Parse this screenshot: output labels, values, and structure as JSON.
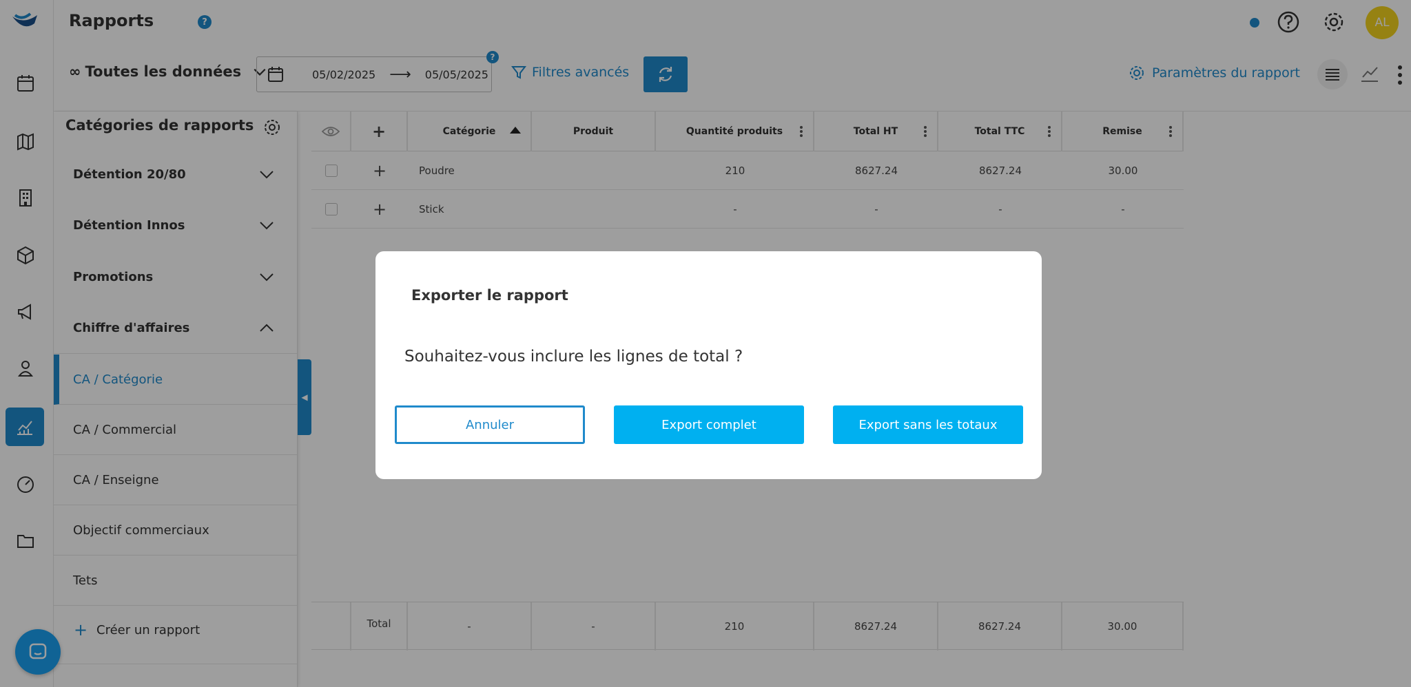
{
  "header": {
    "title": "Rapports",
    "help_glyph": "?",
    "avatar_initials": "AL"
  },
  "toolbar": {
    "dataset_label": "Toutes les données",
    "date_start": "05/02/2025",
    "date_end": "05/05/2025",
    "date_help_glyph": "?",
    "filters_label": "Filtres avancés",
    "params_label": "Paramètres du rapport"
  },
  "sidebar": {
    "title": "Catégories de rapports",
    "sections": [
      {
        "label": "Détention 20/80",
        "expanded": false
      },
      {
        "label": "Détention Innos",
        "expanded": false
      },
      {
        "label": "Promotions",
        "expanded": false
      },
      {
        "label": "Chiffre d'affaires",
        "expanded": true
      }
    ],
    "items": [
      {
        "label": "CA / Catégorie",
        "active": true
      },
      {
        "label": "CA / Commercial",
        "active": false
      },
      {
        "label": "CA / Enseigne",
        "active": false
      },
      {
        "label": "Objectif commerciaux",
        "active": false
      },
      {
        "label": "Tets",
        "active": false
      }
    ],
    "create_label": "Créer un rapport"
  },
  "table": {
    "columns": [
      "Catégorie",
      "Produit",
      "Quantité produits",
      "Total HT",
      "Total TTC",
      "Remise"
    ],
    "rows": [
      {
        "categorie": "Poudre",
        "produit": "",
        "quantite": "210",
        "total_ht": "8627.24",
        "total_ttc": "8627.24",
        "remise": "30.00"
      },
      {
        "categorie": "Stick",
        "produit": "",
        "quantite": "-",
        "total_ht": "-",
        "total_ttc": "-",
        "remise": "-"
      }
    ],
    "footer": {
      "label": "Total",
      "categorie": "-",
      "produit": "-",
      "quantite": "210",
      "total_ht": "8627.24",
      "total_ttc": "8627.24",
      "remise": "30.00"
    }
  },
  "modal": {
    "title": "Exporter le rapport",
    "question": "Souhaitez-vous inclure les lignes de total ?",
    "cancel_label": "Annuler",
    "export_full_label": "Export complet",
    "export_no_totals_label": "Export sans les totaux"
  },
  "colors": {
    "accent": "#1f8acb",
    "button_primary": "#00b0f0",
    "avatar": "#f2d21d"
  },
  "icons": {
    "rail": [
      "logo-icon",
      "calendar-icon",
      "map-icon",
      "building-icon",
      "box-icon",
      "megaphone-icon",
      "user-pin-icon",
      "chart-icon",
      "gauge-icon",
      "folder-icon"
    ],
    "header": [
      "help-circle-icon",
      "settings-gear-icon"
    ]
  }
}
